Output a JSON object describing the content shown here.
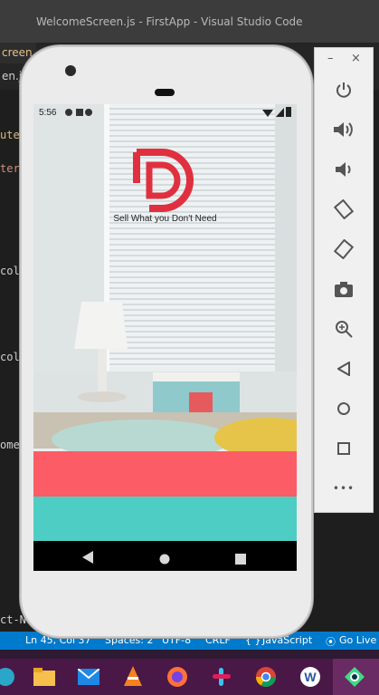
{
  "window": {
    "title": "WelcomeScreen.js - FirstApp - Visual Studio Code"
  },
  "tabs": {
    "active": "creen.js M",
    "second": "en.js"
  },
  "code": {
    "line1": "ute",
    "line2": "ter",
    "line3": "col",
    "line4": "col",
    "line5": "omeS",
    "line6": "ct-Na"
  },
  "status_bar": {
    "position": "Ln 45, Col 37",
    "spaces": "Spaces: 2",
    "encoding": "UTF-8",
    "eol": "CRLF",
    "language": "JavaScript",
    "golive": "Go Live"
  },
  "phone": {
    "time": "5:56",
    "tagline": "Sell What you Don't Need",
    "colors": {
      "brand": "#e0303f",
      "login": "#fc5c65",
      "register": "#4ecdc4"
    }
  },
  "emulator": {
    "minimize": "–",
    "close": "×",
    "more": "•••"
  },
  "taskbar": {
    "icons": [
      "windows-icon",
      "file-explorer-icon",
      "mail-icon",
      "vlc-icon",
      "firefox-icon",
      "slack-icon",
      "chrome-icon",
      "word-icon",
      "android-studio-icon"
    ]
  }
}
